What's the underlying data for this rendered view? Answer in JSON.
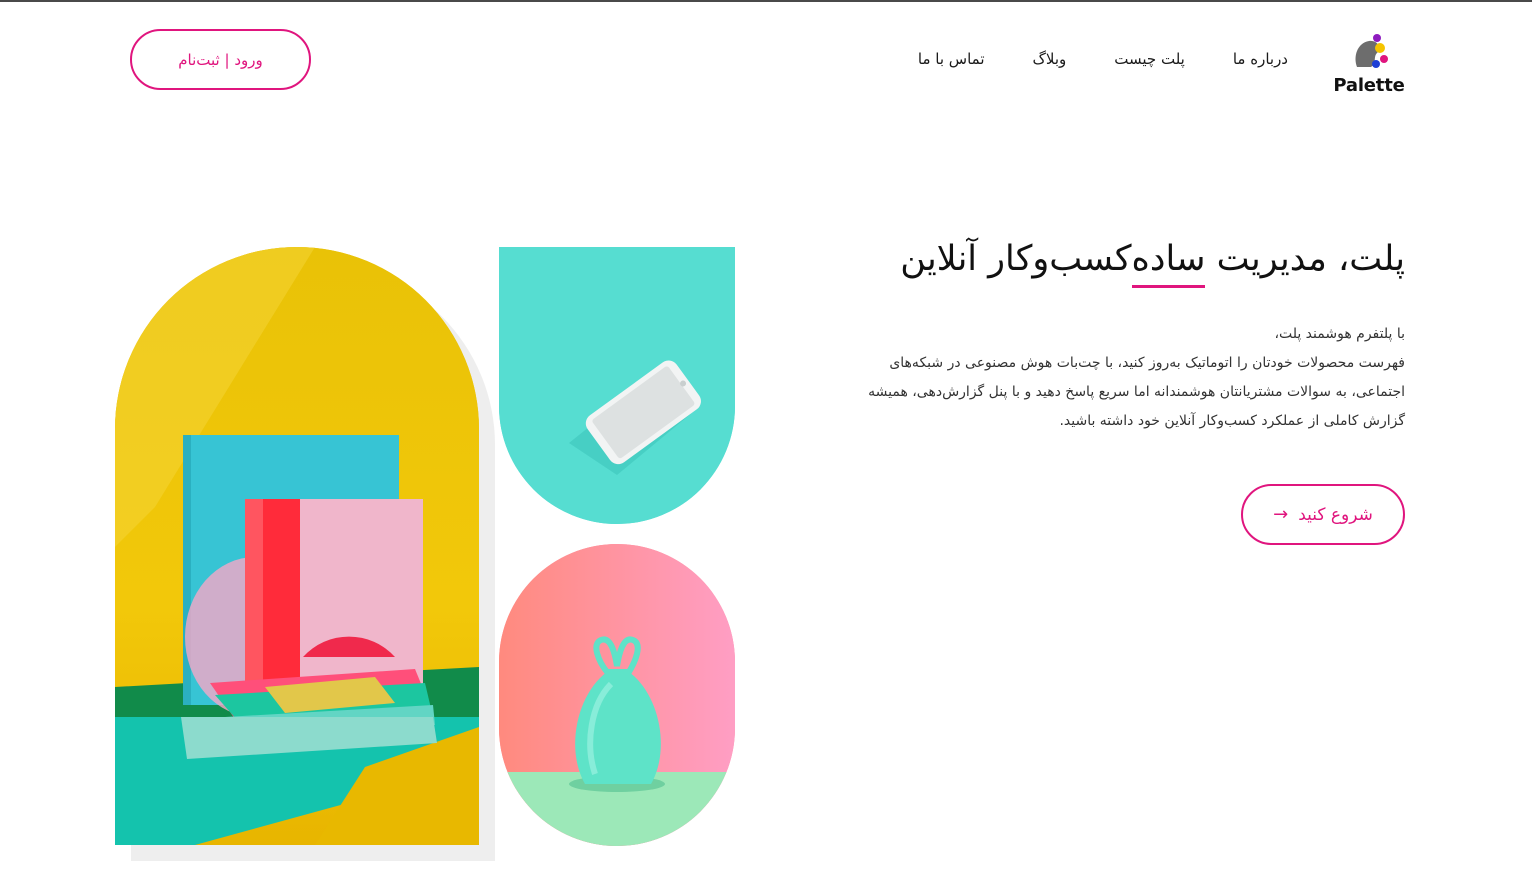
{
  "brand": {
    "name": "Palette"
  },
  "nav": {
    "items": [
      {
        "label": "درباره ما"
      },
      {
        "label": "پلت چیست"
      },
      {
        "label": "وبلاگ"
      },
      {
        "label": "تماس با ما"
      }
    ]
  },
  "header": {
    "login_label": "ورود | ثبت‌نام"
  },
  "hero": {
    "title_prefix": "پلت، مدیریت ",
    "title_highlight": "ساده",
    "title_suffix": "کسب‌وکار آنلاین",
    "desc_line1": "با پلتفرم هوشمند پلت،",
    "desc_line2": "فهرست محصولات خودتان را اتوماتیک به‌روز کنید، با چت‌بات هوش مصنوعی در شبکه‌های",
    "desc_line3": "اجتماعی، به سوالات مشتریانتان هوشمندانه اما سریع پاسخ دهید و با پنل گزارش‌دهی، همیشه",
    "desc_line4": "گزارش کاملی از عملکرد کسب‌وکار آنلاین خود داشته باشید.",
    "cta_label": "شروع کنید",
    "cta_icon": "arrow-left-icon"
  },
  "colors": {
    "accent": "#e0157e",
    "teal": "#56ddd1",
    "yellow": "#ecc20a",
    "pink": "#ff8f9e"
  }
}
